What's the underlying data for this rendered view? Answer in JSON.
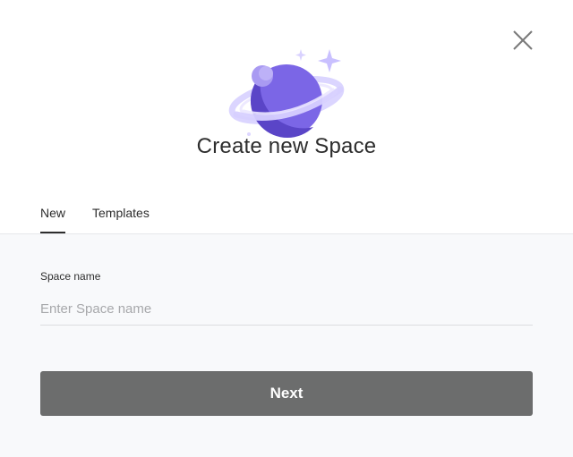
{
  "dialog": {
    "title": "Create new Space",
    "close_icon": "close-icon",
    "illustration": "planet-illustration"
  },
  "tabs": [
    {
      "label": "New",
      "active": true
    },
    {
      "label": "Templates",
      "active": false
    }
  ],
  "form": {
    "space_name_label": "Space name",
    "space_name_value": "",
    "space_name_placeholder": "Enter Space name"
  },
  "actions": {
    "next_label": "Next"
  },
  "colors": {
    "planet": "#7b66e6",
    "planet_shadow": "#5a45c7",
    "ring": "#d7d0ff",
    "sparkle": "#c9c0ff",
    "button": "#6c6d6d",
    "text": "#2d2d2d"
  }
}
